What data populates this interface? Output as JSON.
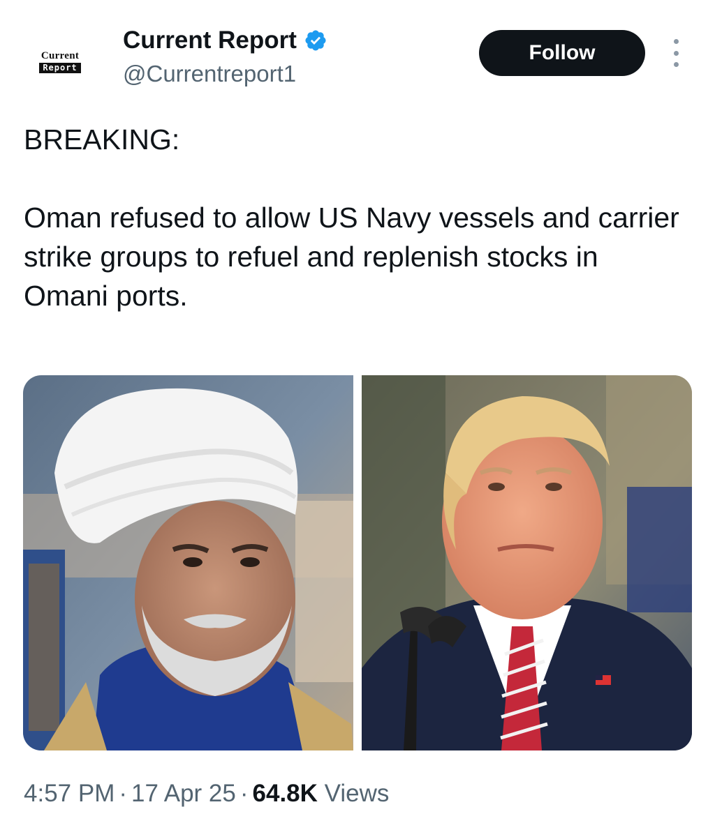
{
  "header": {
    "avatar_logo_top": "Current",
    "avatar_logo_bottom": "Report",
    "display_name": "Current Report",
    "handle": "@Currentreport1",
    "follow_label": "Follow",
    "verified_icon": "verified-badge-icon",
    "more_icon": "more-vertical-icon",
    "accent_color": "#1d9bf0"
  },
  "tweet": {
    "headline": "BREAKING:",
    "body": "Oman refused to allow US Navy vessels and carrier strike groups to refuel and replenish stocks in Omani ports."
  },
  "media": {
    "photos": [
      {
        "name": "photo-left-turbaned-man-in-blue-robe"
      },
      {
        "name": "photo-right-man-in-suit-at-microphone"
      }
    ]
  },
  "footer": {
    "time": "4:57 PM",
    "date": "17 Apr 25",
    "views_count": "64.8K",
    "views_label": "Views",
    "separator": "·"
  }
}
